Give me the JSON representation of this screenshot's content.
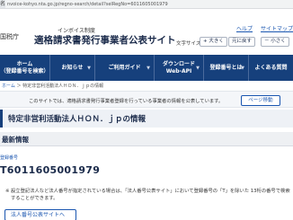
{
  "browser": {
    "tab_fragment": "名",
    "url": "nvoice-kohyo.nta.go.jp/regno-search/detail?selRegNo=6011605001979"
  },
  "header": {
    "agency": "国税庁",
    "subtitle": "インボイス制度",
    "title": "適格請求書発行事業者公表サイト",
    "help": "ヘルプ",
    "sitemap": "サイトマップ",
    "font_size_label": "文字サイズ",
    "size_up": "+ 大きく",
    "size_standard": "元に戻す",
    "size_down": "－ 小さく"
  },
  "nav": {
    "home_line1": "ホーム",
    "home_line2": "（登録番号を検索）",
    "item1": "お知らせ",
    "item2": "ご利用ガイド",
    "item3_line1": "ダウンロード",
    "item3_line2": "Web-API",
    "item4": "登録番号とは",
    "item5": "よくある質問"
  },
  "breadcrumb": {
    "home": "ホーム",
    "separator": "＞",
    "current": "特定非営利活動法人ＨＯＮ．ｊｐの情報"
  },
  "notice": {
    "text": "このサイトでは、適格請求書発行事業者登録を行っている事業者の情報を公表しています。",
    "back_button": "ページ移動"
  },
  "corp": {
    "title": "特定非営利活動法人ＨＯＮ．ｊｐの情報"
  },
  "latest": {
    "title": "最新情報",
    "reg_label": "登録番号",
    "reg_number": "T6011605001979",
    "note_mark": "※",
    "note": "設立登記法人など法人番号が指定されている場合は、「法人番号公表サイト」において登録番号の「T」を除いた 13桁の番号で検索することができます。",
    "pubsite_button": "法人番号公表サイトへ"
  },
  "colors": {
    "nav_bg": "#16407c",
    "link": "#1a56b0"
  }
}
